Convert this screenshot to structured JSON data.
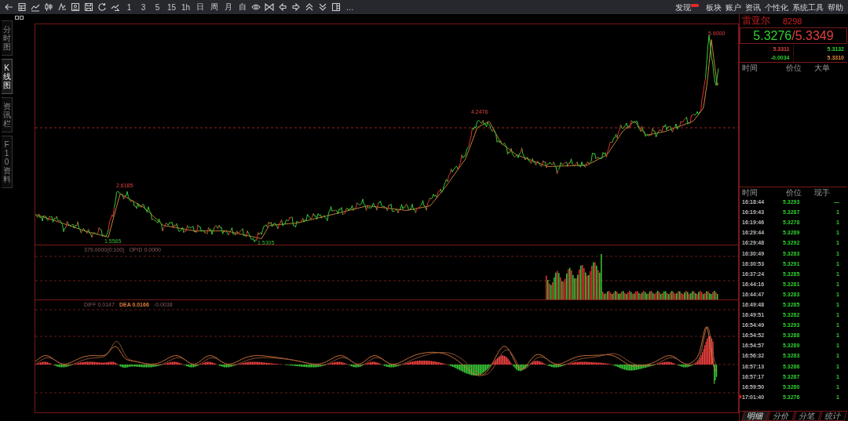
{
  "toolbar": {
    "period_buttons": [
      "1",
      "3",
      "5",
      "15",
      "1h",
      "日",
      "周",
      "月",
      "自"
    ],
    "more": "…",
    "menu": [
      {
        "label": "发现",
        "badge": true
      },
      {
        "label": "板块",
        "badge": false
      },
      {
        "label": "账户",
        "badge": false
      },
      {
        "label": "资讯",
        "badge": false
      },
      {
        "label": "个性化",
        "badge": false
      },
      {
        "label": "系统工具",
        "badge": false
      },
      {
        "label": "帮助",
        "badge": false
      }
    ]
  },
  "side_tabs": [
    {
      "label": "分时图",
      "selected": false
    },
    {
      "label": "K线图",
      "selected": true
    },
    {
      "label": "资讯栏",
      "selected": false
    },
    {
      "label": "F10资料",
      "selected": false
    }
  ],
  "price_chart": {
    "annotations": [
      {
        "text": "2.6185",
        "kind": "high"
      },
      {
        "text": "1.5565",
        "kind": "low"
      },
      {
        "text": "1.5305",
        "kind": "low"
      },
      {
        "text": "4.2476",
        "kind": "high"
      },
      {
        "text": "5.9000",
        "kind": "high"
      }
    ]
  },
  "volume_panel": {
    "legend": [
      {
        "text": "379.0000(0:100)",
        "kind": "plain"
      },
      {
        "text": "OPID 0.0000",
        "kind": "plain"
      }
    ]
  },
  "macd_panel": {
    "legend": [
      {
        "text": "DIFF 0.0147",
        "kind": "plain"
      },
      {
        "text": "DEA 0.0166",
        "kind": "accent"
      },
      {
        "text": "-0.0038",
        "kind": "plain"
      }
    ]
  },
  "quote": {
    "name": "雷亚尔",
    "code": "8298",
    "bid": "5.3276",
    "separator": "/",
    "ask": "5.3349",
    "grid": [
      {
        "text": "5.3311",
        "kind": "up"
      },
      {
        "text": "5.3132",
        "kind": "down"
      },
      {
        "text": "-0.0034",
        "kind": "down"
      },
      {
        "text": "5.3310",
        "kind": "flat"
      }
    ],
    "big_orders": {
      "columns": [
        "时间",
        "价位",
        "大单"
      ]
    },
    "trades": {
      "columns": [
        "时间",
        "价位",
        "现手"
      ],
      "rows": [
        {
          "time": "16:18:44",
          "price": "5.3293",
          "volume": "—",
          "current": false
        },
        {
          "time": "16:19:43",
          "price": "5.3287",
          "volume": "1",
          "current": false
        },
        {
          "time": "16:19:46",
          "price": "5.3278",
          "volume": "1",
          "current": false
        },
        {
          "time": "16:29:44",
          "price": "5.3289",
          "volume": "1",
          "current": false
        },
        {
          "time": "16:29:48",
          "price": "5.3292",
          "volume": "1",
          "current": false
        },
        {
          "time": "16:30:49",
          "price": "5.3283",
          "volume": "1",
          "current": false
        },
        {
          "time": "16:30:53",
          "price": "5.3291",
          "volume": "1",
          "current": false
        },
        {
          "time": "16:37:24",
          "price": "5.3285",
          "volume": "1",
          "current": false
        },
        {
          "time": "16:44:16",
          "price": "5.3281",
          "volume": "1",
          "current": false
        },
        {
          "time": "16:44:47",
          "price": "5.3283",
          "volume": "1",
          "current": false
        },
        {
          "time": "16:49:48",
          "price": "5.3285",
          "volume": "1",
          "current": false
        },
        {
          "time": "16:49:51",
          "price": "5.3282",
          "volume": "1",
          "current": false
        },
        {
          "time": "16:54:49",
          "price": "5.3293",
          "volume": "1",
          "current": false
        },
        {
          "time": "16:54:52",
          "price": "5.3288",
          "volume": "1",
          "current": false
        },
        {
          "time": "16:54:57",
          "price": "5.3289",
          "volume": "1",
          "current": false
        },
        {
          "time": "16:56:32",
          "price": "5.3283",
          "volume": "1",
          "current": false
        },
        {
          "time": "16:57:13",
          "price": "5.3286",
          "volume": "1",
          "current": false
        },
        {
          "time": "16:57:17",
          "price": "5.3287",
          "volume": "1",
          "current": false
        },
        {
          "time": "16:59:50",
          "price": "5.3280",
          "volume": "1",
          "current": false
        },
        {
          "time": "17:01:40",
          "price": "5.3276",
          "volume": "1",
          "current": true
        }
      ]
    },
    "bottom_tabs": [
      {
        "label": "明细",
        "selected": true
      },
      {
        "label": "分价",
        "selected": false
      },
      {
        "label": "分笔",
        "selected": false
      },
      {
        "label": "统计",
        "selected": false
      }
    ]
  }
}
